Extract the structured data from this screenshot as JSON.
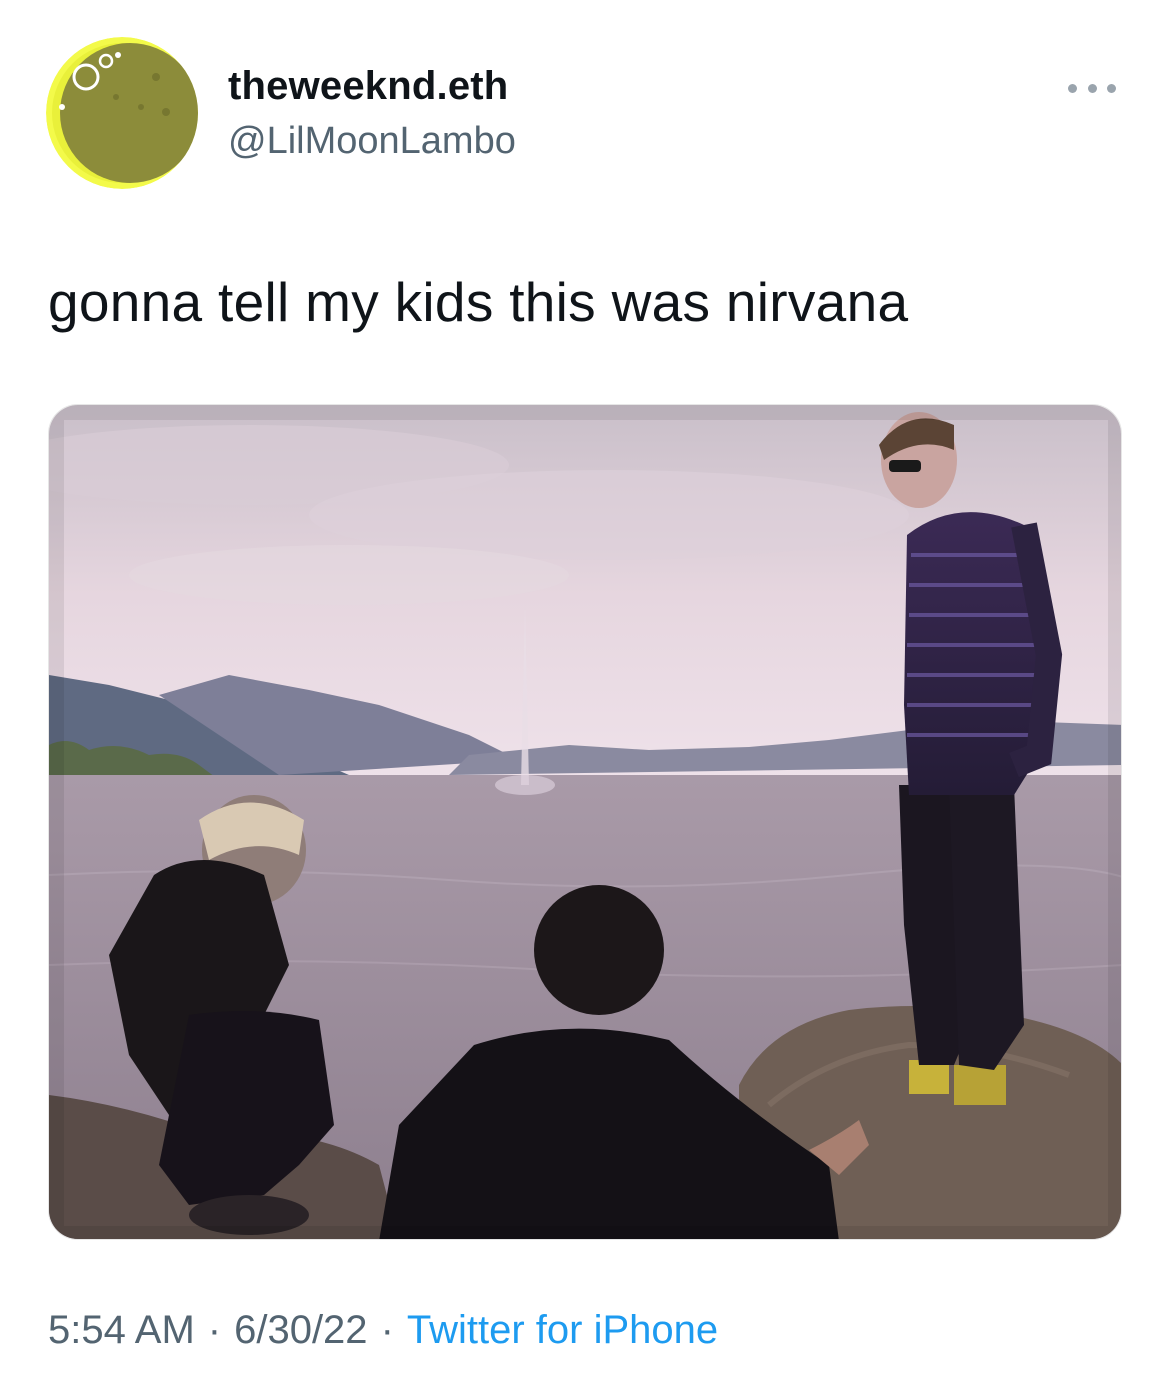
{
  "tweet": {
    "author_name": "theweeknd.eth",
    "author_handle": "@LilMoonLambo",
    "text": "gonna tell my kids this was nirvana",
    "time": "5:54 AM",
    "date": "6/30/22",
    "source": "Twitter for iPhone",
    "separator": "·"
  },
  "icons": {
    "avatar": "moon-avatar-icon",
    "more": "more-dots-icon"
  },
  "colors": {
    "text_primary": "#0f1419",
    "text_secondary": "#536471",
    "link": "#1d9bf0",
    "avatar_moon": "#8f8f3c",
    "avatar_glow": "#e8f236"
  }
}
